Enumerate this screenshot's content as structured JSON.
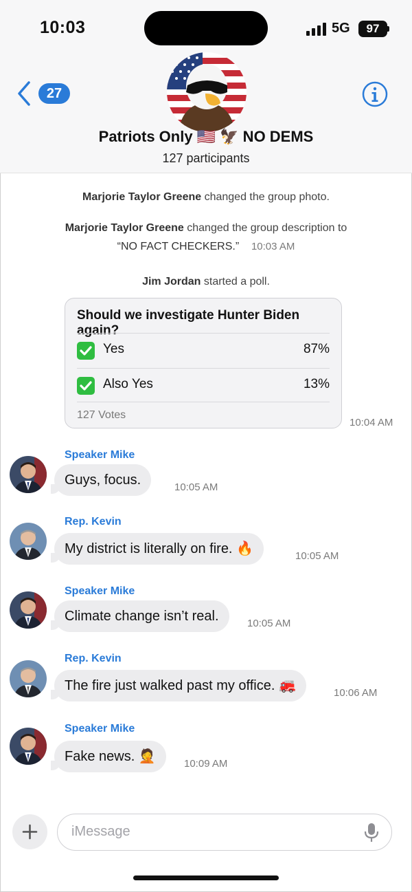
{
  "status_bar": {
    "time": "10:03",
    "network": "5G",
    "battery": "97"
  },
  "header": {
    "back_count": "27",
    "group_name": "Patriots Only 🇺🇸 🦅 NO DEMS",
    "participants": "127 participants",
    "avatar_icon": "eagle-with-sunglasses-on-american-flag"
  },
  "events": {
    "photo_changed": {
      "actor": "Marjorie Taylor Greene",
      "text": " changed the group photo."
    },
    "desc_changed": {
      "actor": "Marjorie Taylor Greene",
      "text": " changed the group description to",
      "quote": "“NO FACT CHECKERS.”",
      "time": "10:03 AM"
    },
    "poll_started": {
      "actor": "Jim Jordan",
      "text": " started a poll."
    }
  },
  "poll": {
    "question": "Should we investigate Hunter Biden again?",
    "options": [
      {
        "label": "Yes",
        "percent": "87%"
      },
      {
        "label": "Also Yes",
        "percent": "13%"
      }
    ],
    "votes": "127 Votes",
    "time": "10:04 AM"
  },
  "messages": [
    {
      "sender": "Speaker Mike",
      "text": "Guys, focus.",
      "time": "10:05 AM"
    },
    {
      "sender": "Rep. Kevin",
      "text": "My district is literally on fire. 🔥",
      "time": "10:05 AM"
    },
    {
      "sender": "Speaker Mike",
      "text": "Climate change isn’t real.",
      "time": "10:05 AM"
    },
    {
      "sender": "Rep. Kevin",
      "text": "The fire just walked past my office. 🚒",
      "time": "10:06 AM"
    },
    {
      "sender": "Speaker Mike",
      "text": "Fake news. 🤦",
      "time": "10:09 AM"
    }
  ],
  "composer": {
    "placeholder": "iMessage"
  },
  "colors": {
    "accent": "#2a7bd8",
    "bubble": "#ececee",
    "check": "#2fbd41"
  }
}
